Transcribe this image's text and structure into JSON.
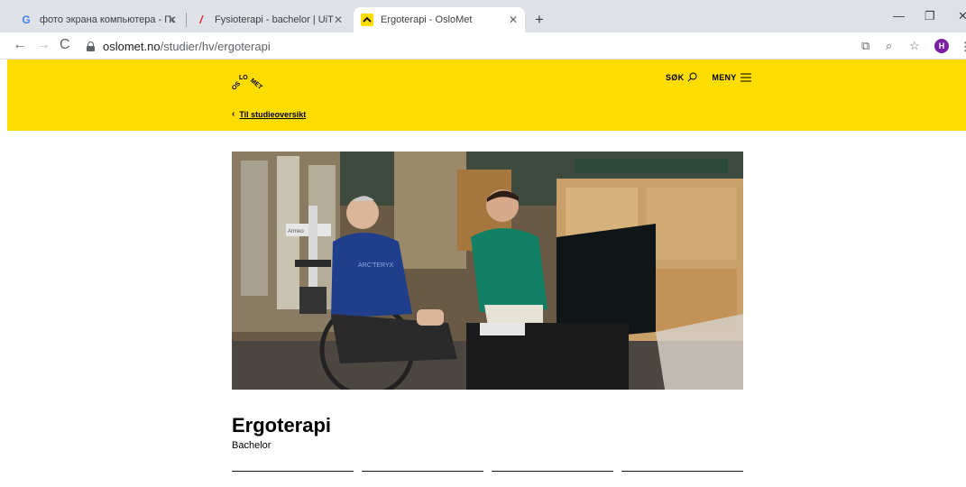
{
  "browser": {
    "tabs": [
      {
        "title": "фото экрана компьютера - Пои",
        "favicon": "google-icon",
        "active": false
      },
      {
        "title": "Fysioterapi - bachelor | UiT",
        "favicon": "uit-icon",
        "active": false
      },
      {
        "title": "Ergoterapi - OsloMet",
        "favicon": "oslomet-icon",
        "active": true
      }
    ],
    "newtab_label": "+",
    "url_host": "oslomet.no",
    "url_path": "/studier/hv/ergoterapi",
    "profile_initial": "H"
  },
  "header": {
    "logo_text": "OSLOMET",
    "search_label": "SØK",
    "menu_label": "MENY",
    "back_link": "Til studieoversikt",
    "accent_color": "#ffdd00"
  },
  "hero": {
    "image": "photo-occupational-therapy-robotic-arm",
    "jersey_text": "ARC'TERYX",
    "device_text": "Armeo"
  },
  "main": {
    "title": "Ergoterapi",
    "subtitle": "Bachelor"
  }
}
